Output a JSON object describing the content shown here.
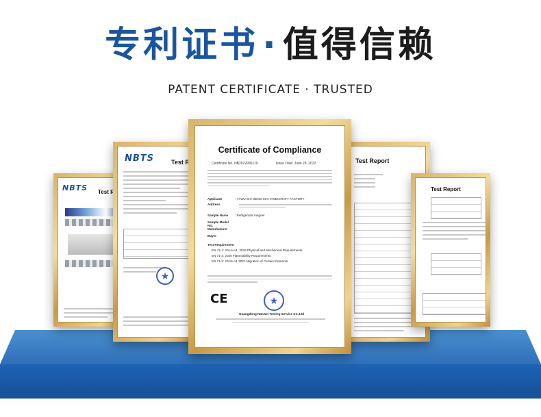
{
  "header": {
    "title_part1": "专利证书",
    "title_dot": "·",
    "title_part2": "值得信赖",
    "subtitle": "PATENT CERTIFICATE · TRUSTED"
  },
  "documents": {
    "far_left": {
      "logo": "NBTS",
      "heading": "Test Re"
    },
    "left": {
      "logo": "NBTS",
      "heading": "Test R"
    },
    "center": {
      "title": "Certificate of Compliance",
      "cert_no": "Certificate No. NB2022996119",
      "issue_date": "Issue Date: June 28, 2022",
      "applicant_label": "Applicant",
      "applicant_value": ": YI WU SHI GENG XIA HANDICRAFT FACTORY",
      "address_label": "Address",
      "sample_name_label": "Sample Name",
      "sample_name_value": ": Refrigerator magnet",
      "sample_model_label": "Sample Model NO.",
      "manufacturer_label": "Manufacturer",
      "buyer_label": "Buyer",
      "test_req_label": "Test Requirement",
      "req1": "EN 71-1: 2014+A1: 2018 Physical and Mechanical Requirements",
      "req2": "EN 71-2: 2020 Flammability Requirements",
      "req3": "EN 71-3: 2019+A1:2021 Migration of Certain Elements",
      "ce_mark": "CE",
      "issuer": "Guangdong Nanwei Testing Service Co.,Ltd"
    },
    "right": {
      "heading": "Test Report"
    },
    "far_right": {
      "heading": "Test Report"
    }
  },
  "colors": {
    "title_blue": "#1a55a0",
    "title_dark": "#1c1c1c",
    "stage_blue": "#2f6fb8",
    "frame_gold": "#d9b36a"
  }
}
